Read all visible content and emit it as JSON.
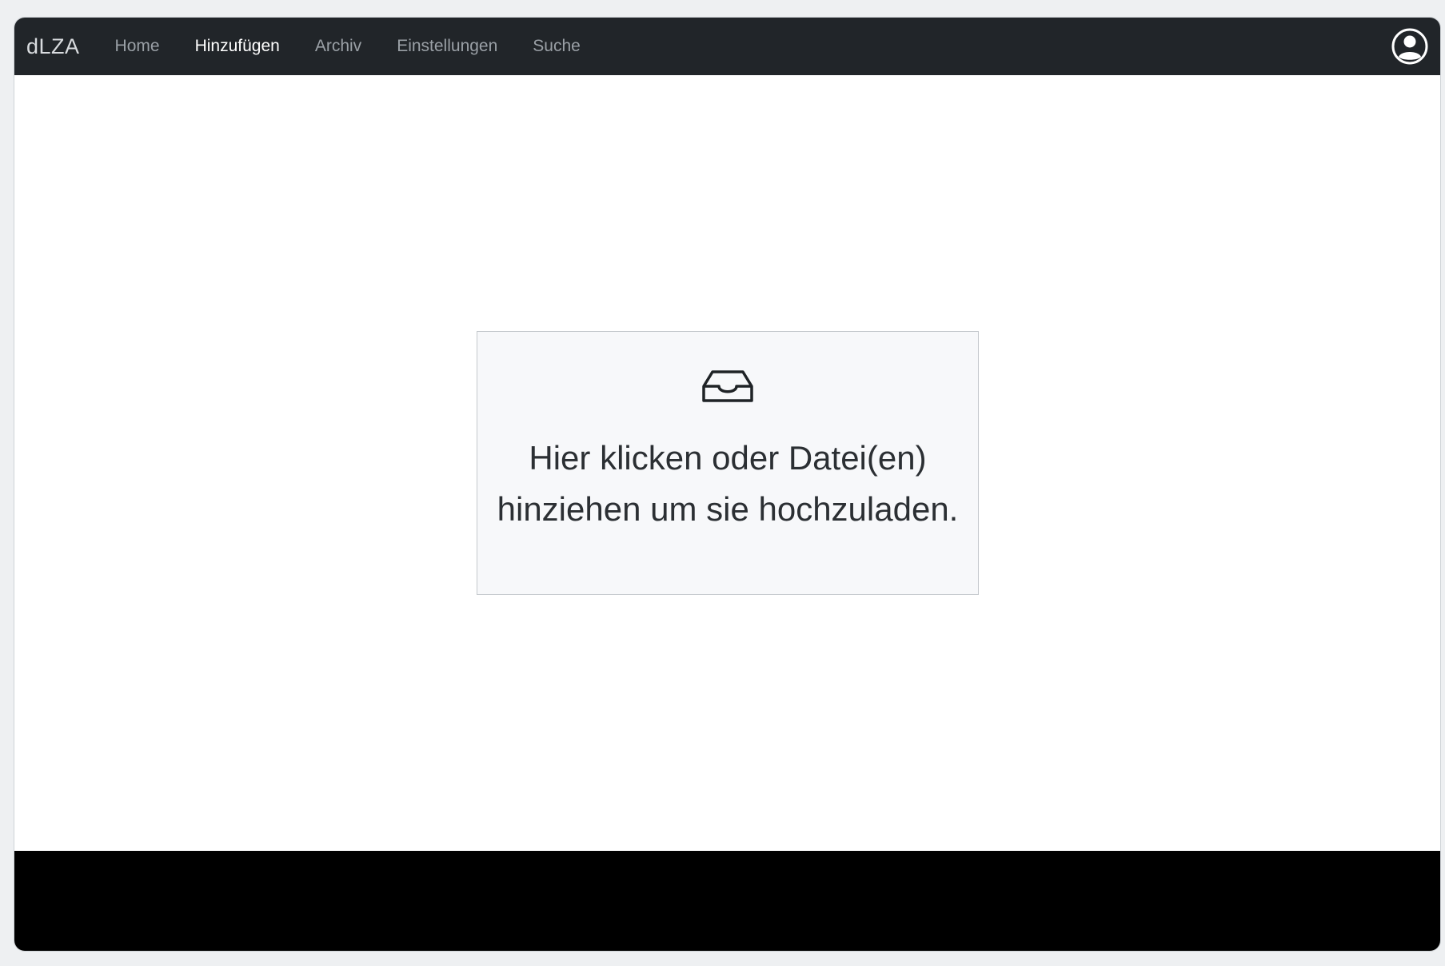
{
  "navbar": {
    "brand": "dLZA",
    "links": [
      {
        "label": "Home",
        "active": false
      },
      {
        "label": "Hinzufügen",
        "active": true
      },
      {
        "label": "Archiv",
        "active": false
      },
      {
        "label": "Einstellungen",
        "active": false
      },
      {
        "label": "Suche",
        "active": false
      }
    ],
    "user_icon": "user-circle-icon"
  },
  "dropzone": {
    "icon": "inbox-icon",
    "line1": "Hier klicken oder Datei(en)",
    "line2": "hinziehen um sie hochzuladen."
  },
  "colors": {
    "navbar_bg": "#212529",
    "footer_bg": "#000000",
    "dropzone_bg": "#f7f8fa"
  }
}
